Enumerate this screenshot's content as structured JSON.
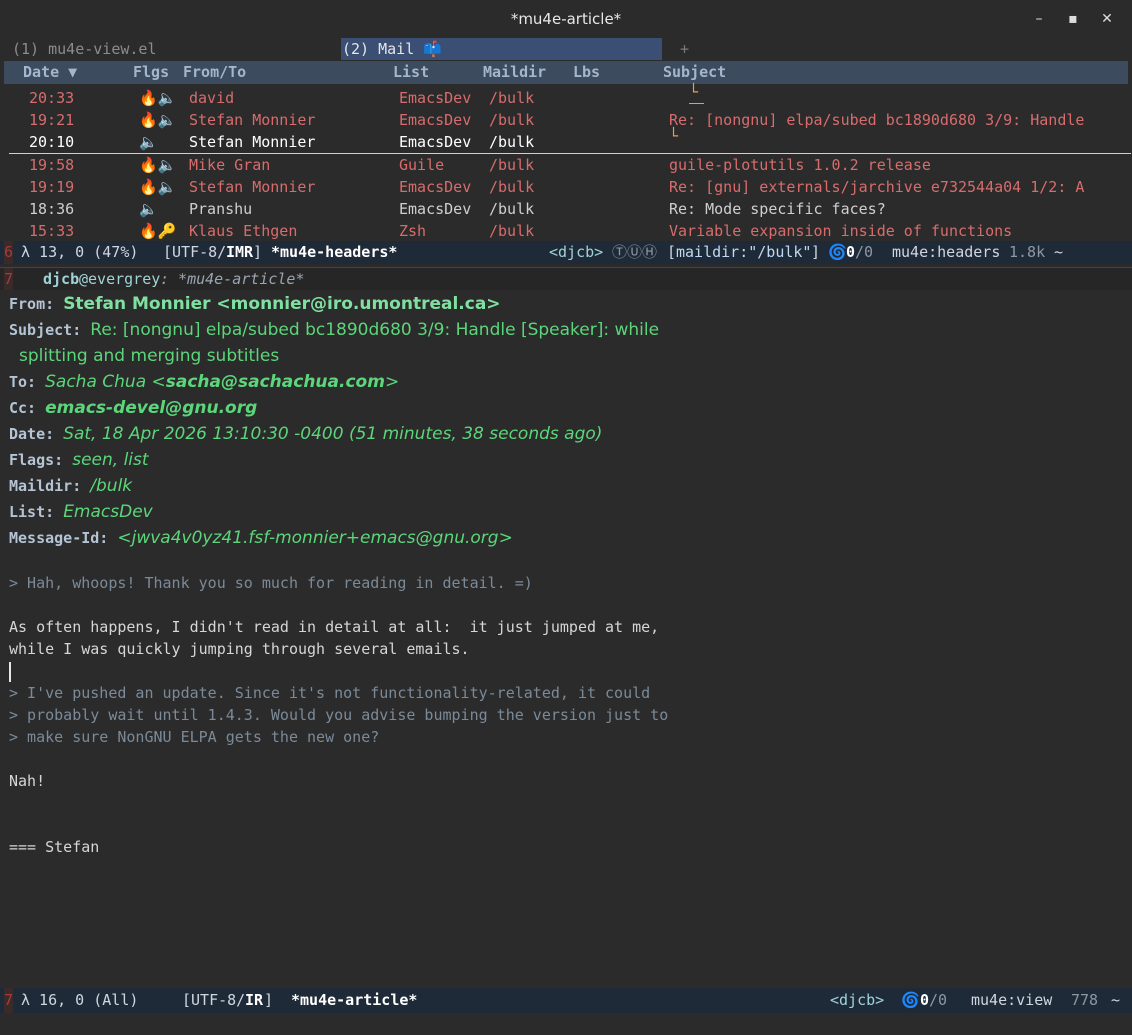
{
  "window": {
    "title": "*mu4e-article*",
    "min": "–",
    "max": "▪",
    "close": "✕"
  },
  "tabs": [
    {
      "label": "(1) mu4e-view.el"
    },
    {
      "label": "(2) Mail 📫"
    }
  ],
  "tab_plus": "+",
  "headers_columns": {
    "date": "Date ▼",
    "flags": "Flgs",
    "from": "From/To",
    "list": "List",
    "maildir": "Maildir",
    "labels": "Lbs",
    "subject": "Subject"
  },
  "messages": [
    {
      "date": "20:33",
      "flags": "🔥🔈",
      "from": "david",
      "list": "EmacsDev",
      "maildir": "/bulk",
      "subject": "└",
      "style": "red"
    },
    {
      "date": "19:21",
      "flags": "🔥🔈",
      "from": "Stefan Monnier",
      "list": "EmacsDev",
      "maildir": "/bulk",
      "subject": "Re: [nongnu] elpa/subed bc1890d680 3/9: Handle",
      "style": "red"
    },
    {
      "date": "20:10",
      "flags": "🔈",
      "from": "Stefan Monnier",
      "list": "EmacsDev",
      "maildir": "/bulk",
      "subject": "└",
      "style": "cur"
    },
    {
      "date": "19:58",
      "flags": "🔥🔈",
      "from": "Mike Gran",
      "list": "Guile",
      "maildir": "/bulk",
      "subject": "guile-plotutils 1.0.2 release",
      "style": "red"
    },
    {
      "date": "19:19",
      "flags": "🔥🔈",
      "from": "Stefan Monnier",
      "list": "EmacsDev",
      "maildir": "/bulk",
      "subject": "Re: [gnu] externals/jarchive e732544a04 1/2: A",
      "style": "red"
    },
    {
      "date": "18:36",
      "flags": "🔈",
      "from": "Pranshu",
      "list": "EmacsDev",
      "maildir": "/bulk",
      "subject": "Re: Mode specific faces?",
      "style": "plain"
    },
    {
      "date": "15:33",
      "flags": "🔥🔑",
      "from": "Klaus Ethgen",
      "list": "Zsh",
      "maildir": "/bulk",
      "subject": "Variable expansion inside of functions",
      "style": "red"
    }
  ],
  "headers_modeline": {
    "winnum": "6",
    "pos": "λ 13, 0 (47%)",
    "enc_open": "[UTF-8/",
    "enc_flags": "IMR",
    "enc_close": "]",
    "buffer": "*mu4e-headers*",
    "user": "<djcb>",
    "icons": "ⓉⓊⒽ",
    "query_open": "[",
    "query": "maildir:\"/bulk\"",
    "query_close": "]",
    "counter_icon": "🌀",
    "counter_a": "0",
    "counter_b": "/0",
    "mode": "mu4e:headers",
    "size": "1.8k",
    "tilde": "~"
  },
  "view_header": {
    "winnum": "7",
    "user": "djcb",
    "host": "@evergrey",
    "buffer": ": *mu4e-article*"
  },
  "message": {
    "from_label": "From:",
    "from": "Stefan Monnier <monnier@iro.umontreal.ca>",
    "subject_label": "Subject:",
    "subject_1": "Re: [nongnu] elpa/subed bc1890d680 3/9: Handle [Speaker]: while",
    "subject_2": "splitting and merging subtitles",
    "to_label": "To:",
    "to_name": "Sacha Chua <",
    "to_addr": "sacha@sachachua.com",
    "to_close": ">",
    "cc_label": "Cc:",
    "cc": "emacs-devel@gnu.org",
    "date_label": "Date:",
    "date": "Sat, 18 Apr 2026 13:10:30 -0400 (51 minutes, 38 seconds ago)",
    "flags_label": "Flags:",
    "flags": "seen, list",
    "maildir_label": "Maildir:",
    "maildir": "/bulk",
    "list_label": "List:",
    "list": "EmacsDev",
    "msgid_label": "Message-Id:",
    "msgid": "<jwva4v0yz41.fsf-monnier+emacs@gnu.org>"
  },
  "body_lines": [
    {
      "text": "> Hah, whoops! Thank you so much for reading in detail. =)",
      "kind": "quote"
    },
    {
      "text": "",
      "kind": "txt"
    },
    {
      "text": "As often happens, I didn't read in detail at all:  it just jumped at me,",
      "kind": "txt"
    },
    {
      "text": "while I was quickly jumping through several emails.",
      "kind": "txt"
    },
    {
      "text": "",
      "kind": "cursor"
    },
    {
      "text": "> I've pushed an update. Since it's not functionality-related, it could",
      "kind": "quote"
    },
    {
      "text": "> probably wait until 1.4.3. Would you advise bumping the version just to",
      "kind": "quote"
    },
    {
      "text": "> make sure NonGNU ELPA gets the new one?",
      "kind": "quote"
    },
    {
      "text": "",
      "kind": "txt"
    },
    {
      "text": "Nah!",
      "kind": "txt"
    },
    {
      "text": "",
      "kind": "txt"
    },
    {
      "text": "",
      "kind": "txt"
    },
    {
      "text": "=== Stefan",
      "kind": "txt"
    }
  ],
  "view_modeline": {
    "winnum": "7",
    "pos": "λ 16, 0 (All)",
    "enc_open": "[UTF-8/",
    "enc_flags": "IR",
    "enc_close": "]",
    "buffer": "*mu4e-article*",
    "user": "<djcb>",
    "counter_icon": "🌀",
    "counter_a": "0",
    "counter_b": "/0",
    "mode": "mu4e:view",
    "size": "778",
    "tilde": "~"
  }
}
